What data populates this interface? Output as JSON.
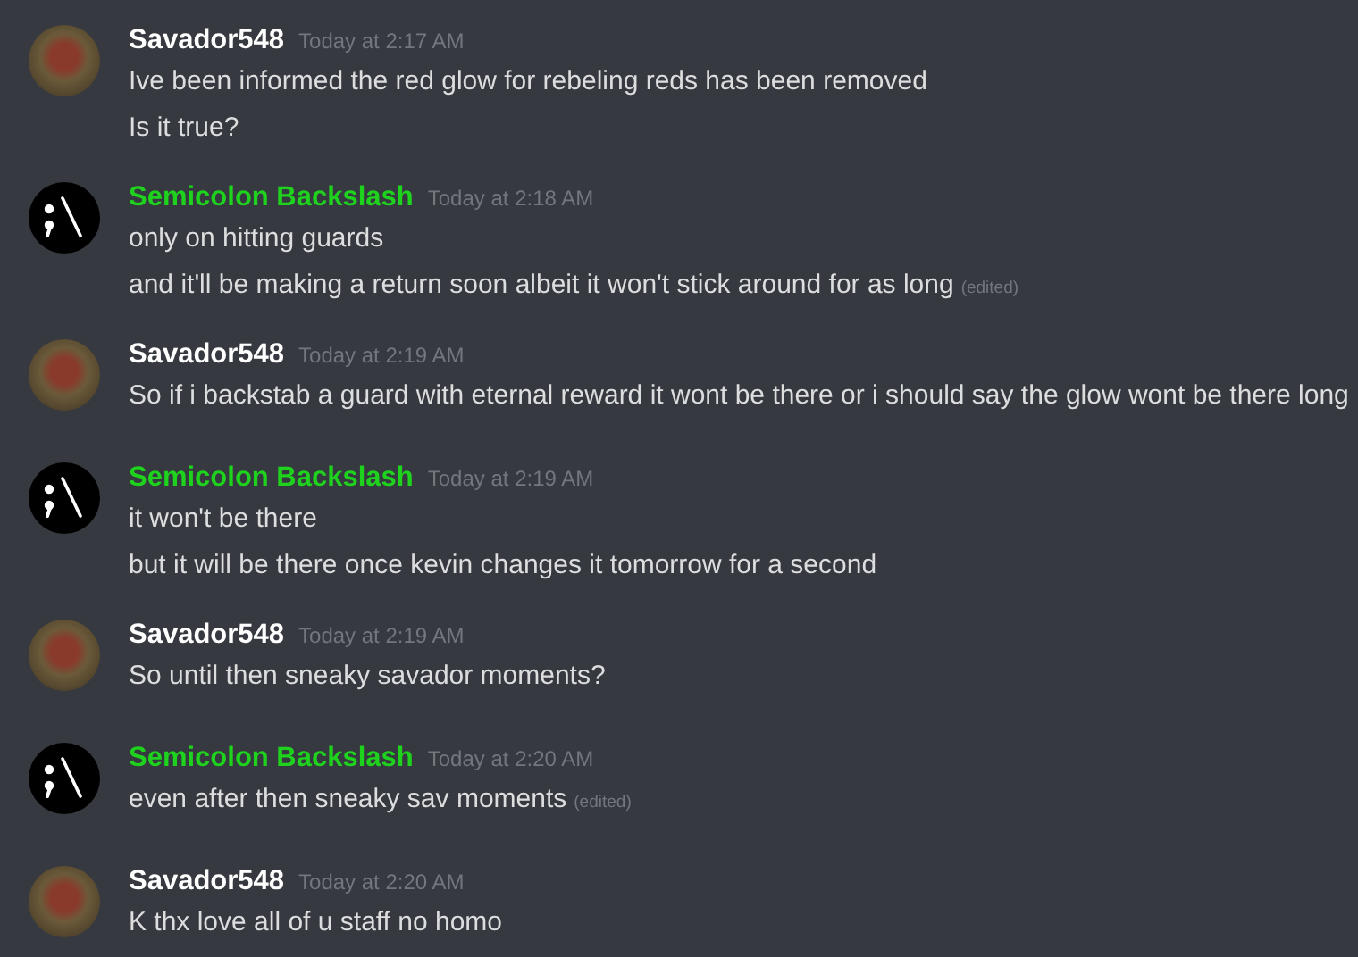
{
  "messages": [
    {
      "author": "Savador548",
      "color": "#ffffff",
      "kind": "photo",
      "timestamp": "Today at 2:17 AM",
      "lines": [
        {
          "text": "Ive been informed the red glow for rebeling reds has been removed"
        },
        {
          "text": "Is it true?"
        }
      ]
    },
    {
      "author": "Semicolon Backslash",
      "color": "#1ed21e",
      "kind": "logo",
      "timestamp": "Today at 2:18 AM",
      "lines": [
        {
          "text": "only on hitting guards"
        },
        {
          "text": "and it'll be making a return soon albeit it won't stick around for as long",
          "edited": "(edited)"
        }
      ]
    },
    {
      "author": "Savador548",
      "color": "#ffffff",
      "kind": "photo",
      "timestamp": "Today at 2:19 AM",
      "lines": [
        {
          "text": "So if i backstab a guard with eternal reward it wont be there or i should say the glow wont be there long"
        }
      ]
    },
    {
      "author": "Semicolon Backslash",
      "color": "#1ed21e",
      "kind": "logo",
      "timestamp": "Today at 2:19 AM",
      "lines": [
        {
          "text": "it won't be there"
        },
        {
          "text": "but it will be there once kevin changes it tomorrow for a second"
        }
      ]
    },
    {
      "author": "Savador548",
      "color": "#ffffff",
      "kind": "photo",
      "timestamp": "Today at 2:19 AM",
      "lines": [
        {
          "text": "So until then sneaky savador moments?"
        }
      ]
    },
    {
      "author": "Semicolon Backslash",
      "color": "#1ed21e",
      "kind": "logo",
      "timestamp": "Today at 2:20 AM",
      "lines": [
        {
          "text": "even after then sneaky sav moments",
          "edited": "(edited)"
        }
      ]
    },
    {
      "author": "Savador548",
      "color": "#ffffff",
      "kind": "photo",
      "timestamp": "Today at 2:20 AM",
      "lines": [
        {
          "text": "K thx love all of u staff no homo"
        }
      ]
    }
  ]
}
